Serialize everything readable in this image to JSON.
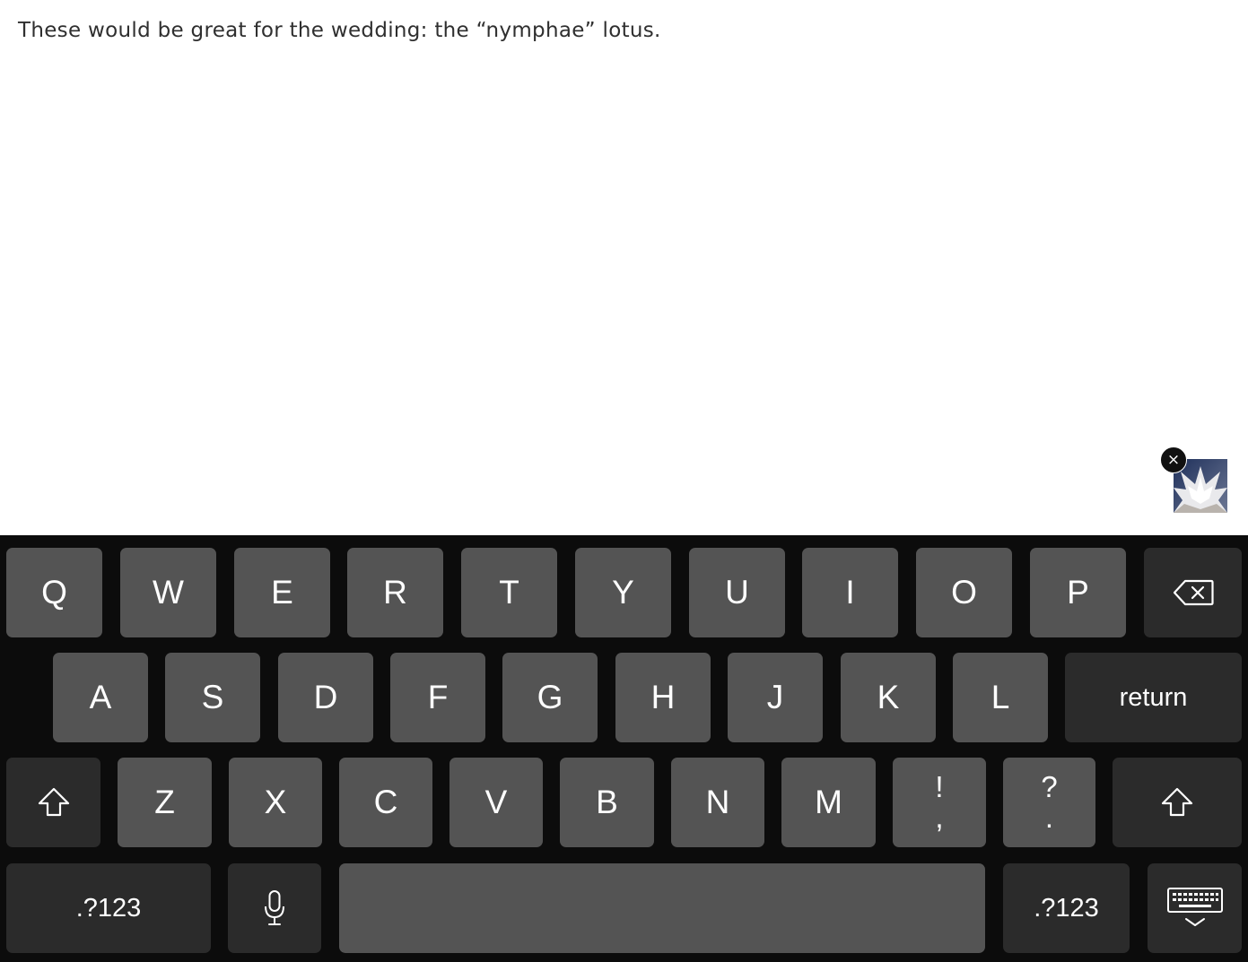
{
  "message": {
    "text": "These would be great for the wedding: the “nymphae” lotus."
  },
  "attachment": {
    "remove_label": "×",
    "thumbnail_icon": "lotus-photo-thumbnail"
  },
  "keyboard": {
    "row1": [
      "Q",
      "W",
      "E",
      "R",
      "T",
      "Y",
      "U",
      "I",
      "O",
      "P"
    ],
    "row2": [
      "A",
      "S",
      "D",
      "F",
      "G",
      "H",
      "J",
      "K",
      "L"
    ],
    "row3": [
      "Z",
      "X",
      "C",
      "V",
      "B",
      "N",
      "M"
    ],
    "punct_exclaim_top": "!",
    "punct_exclaim_bottom": ",",
    "punct_question_top": "?",
    "punct_question_bottom": ".",
    "return_label": "return",
    "numbers_left_label": ".?123",
    "numbers_right_label": ".?123",
    "icons": {
      "backspace": "backspace-icon",
      "shift": "shift-icon",
      "microphone": "microphone-icon",
      "hide_keyboard": "hide-keyboard-icon"
    },
    "colors": {
      "background": "#0c0c0c",
      "key": "#545454",
      "function_key": "#2b2b2b"
    }
  }
}
